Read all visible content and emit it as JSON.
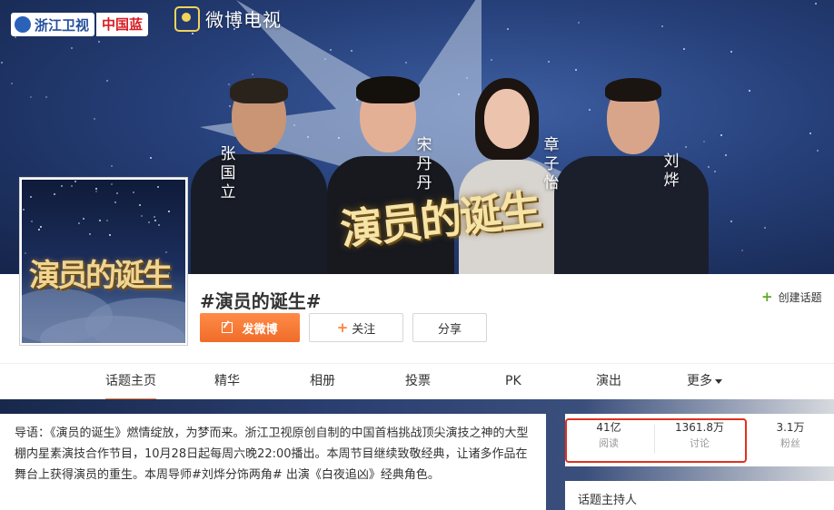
{
  "banner": {
    "channel_logo": "浙江卫视",
    "channel_badge": "中国蓝",
    "platform_logo": "微博电视",
    "show_title_art": "演员的诞生",
    "mentors": [
      "张国立",
      "宋丹丹",
      "章子怡",
      "刘烨"
    ]
  },
  "topic": {
    "avatar_title_art": "演员的诞生",
    "title": "#演员的诞生#",
    "create_topic": "创建话题"
  },
  "actions": {
    "post": "发微博",
    "follow": "关注",
    "share": "分享"
  },
  "nav": {
    "items": [
      "话题主页",
      "精华",
      "相册",
      "投票",
      "PK",
      "演出",
      "更多"
    ],
    "active_index": 0
  },
  "description": "导语：《演员的诞生》燃情绽放，为梦而来。浙江卫视原创自制的中国首档挑战顶尖演技之神的大型棚内星素演技合作节目，10月28日起每周六晚22:00播出。本周节目继续致敬经典，让诸多作品在舞台上获得演员的重生。本周导师#刘烨分饰两角# 出演《白夜追凶》经典角色。",
  "stats": [
    {
      "value": "41亿",
      "label": "阅读"
    },
    {
      "value": "1361.8万",
      "label": "讨论"
    },
    {
      "value": "3.1万",
      "label": "粉丝"
    }
  ],
  "host_section": {
    "title": "话题主持人"
  },
  "colors": {
    "accent": "#ff8140",
    "highlight_border": "#e1301e",
    "create_plus": "#5fa827"
  },
  "icons": [
    "pencil-icon",
    "plus-icon",
    "caret-down-icon",
    "weibo-tv-icon"
  ]
}
